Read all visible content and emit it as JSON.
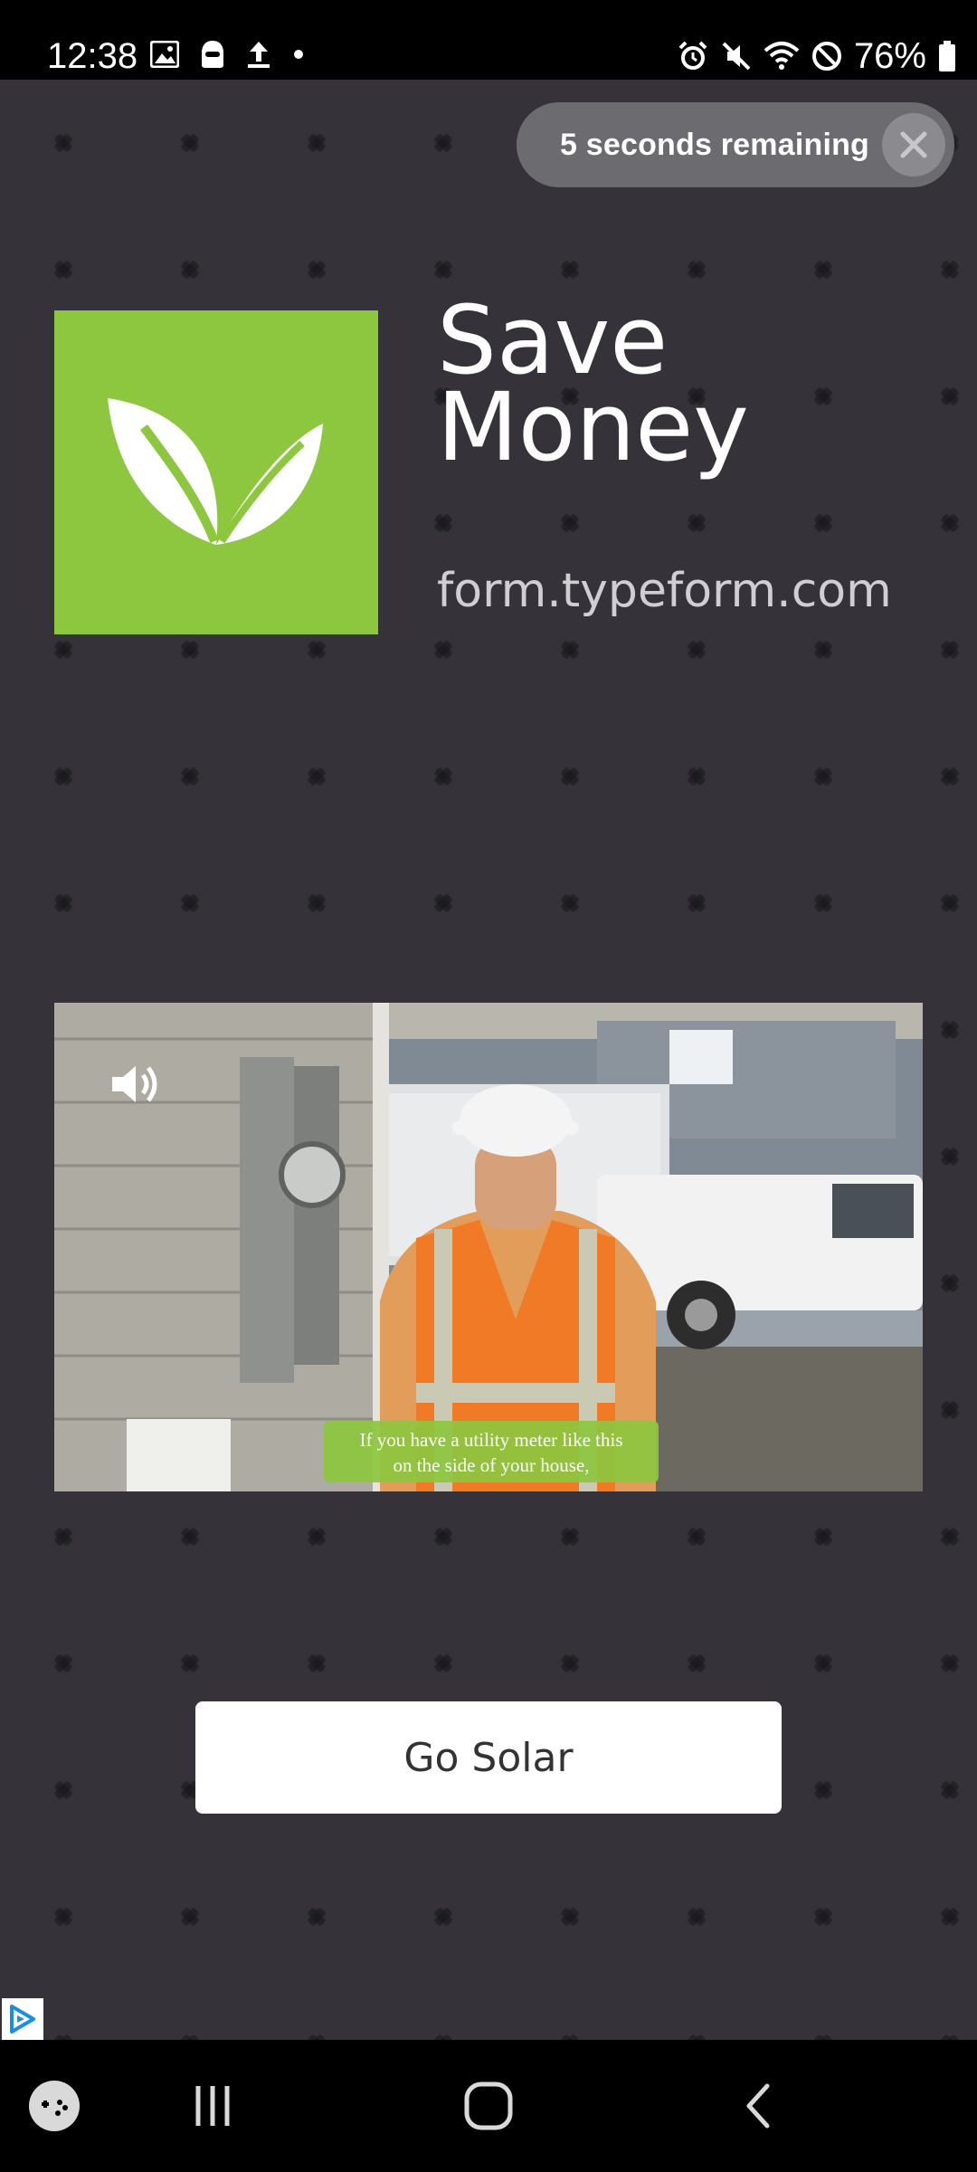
{
  "status_bar": {
    "time": "12:38",
    "battery": "76%",
    "left_icons": [
      "image-icon",
      "bitmoji-icon",
      "upload-icon",
      "dot-icon"
    ],
    "right_icons": [
      "alarm-icon",
      "mute-icon",
      "wifi-icon",
      "dnd-icon",
      "battery-icon"
    ]
  },
  "ad": {
    "skip_text": "5 seconds remaining",
    "title": "Save Money",
    "domain": "form.typeform.com",
    "cta_label": "Go Solar",
    "video": {
      "caption_line1": "If you have a utility meter like this",
      "caption_line2": "on the side of your house,"
    },
    "colors": {
      "brand_green": "#8dc63f",
      "background": "#353339"
    }
  },
  "nav_bar": {
    "buttons": [
      "game-launcher-icon",
      "recents-icon",
      "home-icon",
      "back-icon"
    ]
  }
}
